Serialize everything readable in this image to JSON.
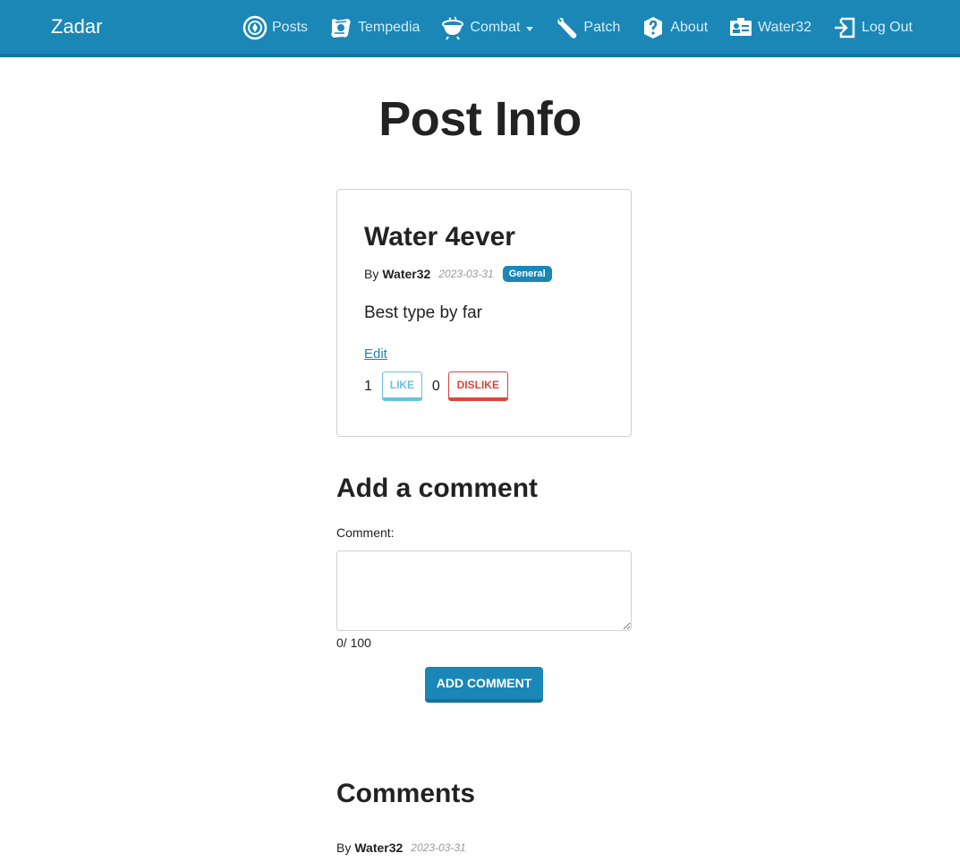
{
  "navbar": {
    "brand": "Zadar",
    "items": [
      {
        "label": "Posts",
        "icon": "coin-icon"
      },
      {
        "label": "Tempedia",
        "icon": "scroll-icon"
      },
      {
        "label": "Combat",
        "icon": "cauldron-icon",
        "dropdown": true
      },
      {
        "label": "Patch",
        "icon": "wrench-icon"
      },
      {
        "label": "About",
        "icon": "question-icon"
      },
      {
        "label": "Water32",
        "icon": "id-card-icon"
      },
      {
        "label": "Log Out",
        "icon": "logout-icon"
      }
    ]
  },
  "page": {
    "title": "Post Info"
  },
  "post": {
    "title": "Water 4ever",
    "by_label": "By",
    "author": "Water32",
    "date": "2023-03-31",
    "category": "General",
    "body": "Best type by far",
    "edit_label": "Edit",
    "likes": "1",
    "like_label": "LIKE",
    "dislikes": "0",
    "dislike_label": "DISLIKE"
  },
  "comment_form": {
    "heading": "Add a comment",
    "label": "Comment:",
    "value": "",
    "char_count": "0/ 100",
    "submit_label": "ADD COMMENT"
  },
  "comments": {
    "heading": "Comments",
    "items": [
      {
        "by_label": "By",
        "author": "Water32",
        "date": "2023-03-31"
      }
    ]
  },
  "colors": {
    "primary": "#1a87b6",
    "like": "#66c2e3",
    "dislike": "#e0433a"
  }
}
